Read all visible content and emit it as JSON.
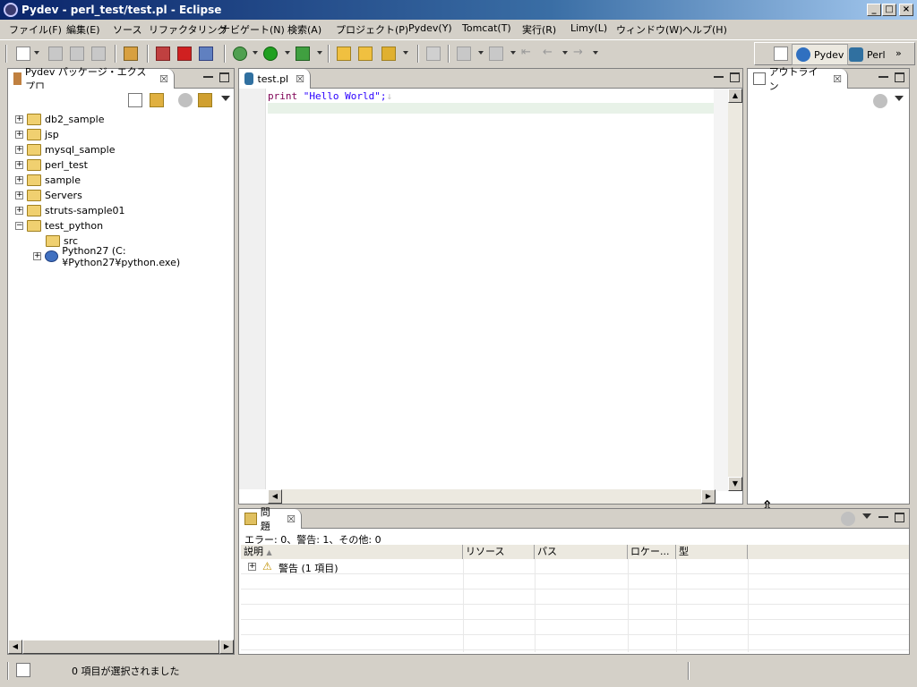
{
  "window": {
    "title": "Pydev - perl_test/test.pl - Eclipse"
  },
  "menu": [
    "ファイル(F)",
    "編集(E)",
    "ソース",
    "リファクタリング",
    "ナビゲート(N)",
    "検索(A)",
    "プロジェクト(P)",
    "Pydev(Y)",
    "Tomcat(T)",
    "実行(R)",
    "Limy(L)",
    "ウィンドウ(W)",
    "ヘルプ(H)"
  ],
  "perspectives": {
    "pydev": "Pydev",
    "perl": "Perl"
  },
  "explorer": {
    "tab_label": "Pydev パッケージ・エクスプロ",
    "items": [
      {
        "label": "db2_sample"
      },
      {
        "label": "jsp"
      },
      {
        "label": "mysql_sample"
      },
      {
        "label": "perl_test"
      },
      {
        "label": "sample"
      },
      {
        "label": "Servers"
      },
      {
        "label": "struts-sample01"
      },
      {
        "label": "test_python"
      },
      {
        "label": "src"
      },
      {
        "label": "Python27  (C:¥Python27¥python.exe)"
      }
    ]
  },
  "editor": {
    "tab_label": "test.pl",
    "code_keyword": "print",
    "code_string": "\"Hello World\";",
    "code_eol": "↓"
  },
  "outline": {
    "tab_label": "アウトライン"
  },
  "problems": {
    "tab_label": "問題",
    "summary": "エラー: 0、警告: 1、その他: 0",
    "columns": [
      "説明",
      "リソース",
      "パス",
      "ロケー...",
      "型"
    ],
    "group_label": "警告 (1 項目)"
  },
  "status": {
    "text": "0 項目が選択されました"
  },
  "colors": {
    "keyword": "#7f0055",
    "string": "#2a00ff",
    "title_start": "#0a246a",
    "current_line": "#e8f2e8"
  }
}
